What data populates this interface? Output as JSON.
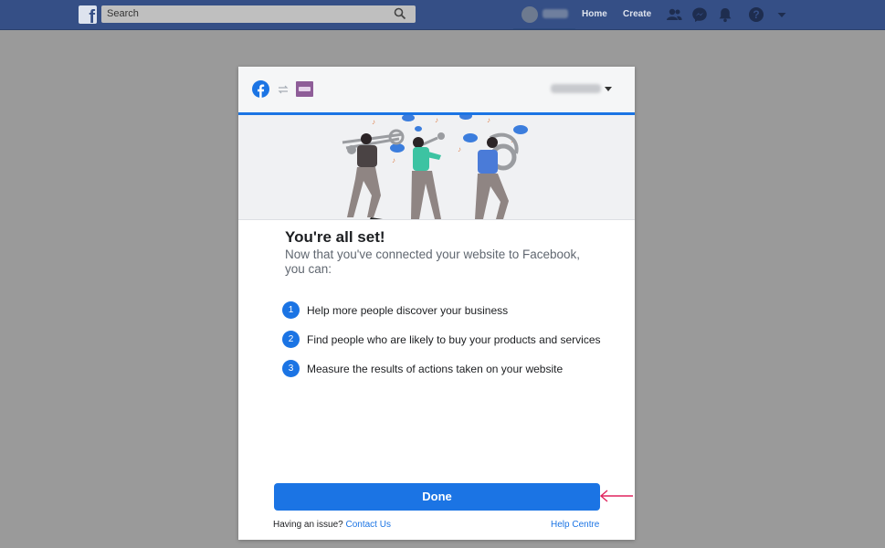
{
  "topbar": {
    "search_placeholder": "Search",
    "nav": {
      "home": "Home",
      "create": "Create"
    }
  },
  "modal": {
    "title": "You're all set!",
    "subtitle": "Now that you've connected your website to Facebook, you can:",
    "steps": [
      {
        "num": "1",
        "text": "Help more people discover your business"
      },
      {
        "num": "2",
        "text": "Find people who are likely to buy your products and services"
      },
      {
        "num": "3",
        "text": "Measure the results of actions taken on your website"
      }
    ],
    "done_label": "Done",
    "footer": {
      "issue_text": "Having an issue?",
      "contact_link": "Contact Us",
      "help_link": "Help Centre"
    }
  },
  "colors": {
    "topbar": "#354f86",
    "accent": "#1b74e4",
    "woo": "#8e5d98",
    "annotation_arrow": "#e0245e"
  },
  "icons": [
    "facebook-logo-icon",
    "search-icon",
    "friends-icon",
    "messenger-icon",
    "notifications-icon",
    "help-icon",
    "menu-caret-icon",
    "swap-icon",
    "woocommerce-icon",
    "arrow-icon"
  ]
}
